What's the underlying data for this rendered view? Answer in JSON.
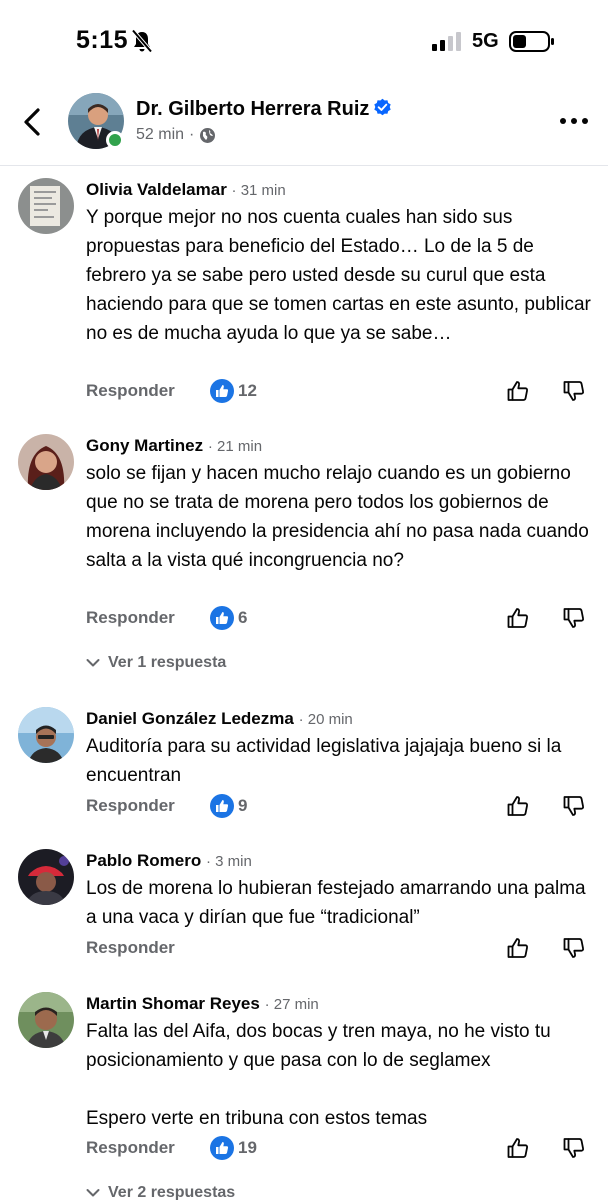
{
  "status_bar": {
    "time": "5:15",
    "network": "5G"
  },
  "header": {
    "name": "Dr. Gilberto Herrera Ruiz",
    "time_ago": "52 min",
    "separator": "·"
  },
  "actions": {
    "reply_label": "Responder"
  },
  "comments": [
    {
      "author": "Olivia Valdelamar",
      "time": "· 31 min",
      "text": "Y porque mejor no nos cuenta cuales han sido sus propuestas para beneficio del Estado… Lo de la 5 de febrero ya se sabe pero usted desde su curul que esta haciendo para que se tomen cartas en este asunto, publicar no es de mucha ayuda lo que ya se sabe…",
      "likes": "12"
    },
    {
      "author": "Gony Martinez",
      "time": "· 21 min",
      "text": "solo se fijan y hacen mucho relajo cuando es un gobierno que no se trata de morena pero todos los gobiernos de morena incluyendo la presidencia ahí no pasa nada cuando salta a la vista qué incongruencia no?",
      "likes": "6",
      "replies_label": "Ver 1 respuesta"
    },
    {
      "author": "Daniel González Ledezma",
      "time": "· 20 min",
      "text": "Auditoría para su actividad legislativa jajajaja bueno si la encuentran",
      "likes": "9"
    },
    {
      "author": "Pablo Romero",
      "time": "· 3 min",
      "text": "Los de morena lo hubieran festejado amarrando una palma a una vaca y dirían que fue “tradicional”"
    },
    {
      "author": "Martin Shomar Reyes",
      "time": "· 27 min",
      "text": "Falta las del Aifa, dos bocas y tren maya, no he visto tu posicionamiento y que pasa con lo de seglamex\n\nEspero verte en tribuna con estos temas",
      "likes": "19",
      "replies_label": "Ver 2 respuestas"
    }
  ],
  "colors": {
    "like_blue": "#1b74e4",
    "online_green": "#31a24c",
    "meta_gray": "#65676b"
  }
}
